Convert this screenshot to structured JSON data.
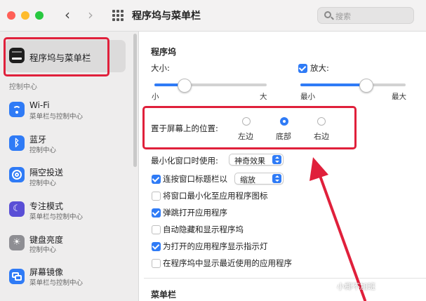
{
  "window": {
    "title": "程序坞与菜单栏"
  },
  "search": {
    "placeholder": "搜索"
  },
  "sidebar": {
    "selected": "程序坞与菜单栏",
    "section_header": "控制中心",
    "items": [
      {
        "label": "Wi-Fi",
        "sub": "菜单栏与控制中心",
        "icon": "wifi-icon",
        "color": "#2f7bf6"
      },
      {
        "label": "蓝牙",
        "sub": "控制中心",
        "icon": "bluetooth-icon",
        "color": "#2f7bf6"
      },
      {
        "label": "隔空投送",
        "sub": "控制中心",
        "icon": "airdrop-icon",
        "color": "#2f7bf6"
      },
      {
        "label": "专注模式",
        "sub": "菜单栏与控制中心",
        "icon": "moon-icon",
        "color": "#5a4fd6"
      },
      {
        "label": "键盘亮度",
        "sub": "控制中心",
        "icon": "brightness-icon",
        "color": "#8e8e93"
      },
      {
        "label": "屏幕镜像",
        "sub": "菜单栏与控制中心",
        "icon": "screen-mirror-icon",
        "color": "#2f7bf6"
      }
    ]
  },
  "dock": {
    "section_title": "程序坞",
    "size": {
      "label": "大小:",
      "min": "小",
      "max": "大",
      "value": 0.2
    },
    "magnify": {
      "label": "放大:",
      "checked": true,
      "min": "最小",
      "max": "最大",
      "value": 0.7
    },
    "position": {
      "label": "置于屏幕上的位置:",
      "options": [
        "左边",
        "底部",
        "右边"
      ],
      "selected": "底部"
    },
    "minimize": {
      "label": "最小化窗口时使用:",
      "value": "神奇效果"
    },
    "double_click": {
      "label": "连按窗口标题栏以",
      "value": "缩放",
      "checked": true
    },
    "checkboxes": [
      {
        "label": "将窗口最小化至应用程序图标",
        "checked": false
      },
      {
        "label": "弹跳打开应用程序",
        "checked": true
      },
      {
        "label": "自动隐藏和显示程序坞",
        "checked": false
      },
      {
        "label": "为打开的应用程序显示指示灯",
        "checked": true
      },
      {
        "label": "在程序坞中显示最近使用的应用程序",
        "checked": false
      }
    ]
  },
  "menubar": {
    "section_title": "菜单栏"
  },
  "watermark": "小椰不加班",
  "colors": {
    "accent": "#2f7bf6",
    "callout": "#e0203b"
  }
}
